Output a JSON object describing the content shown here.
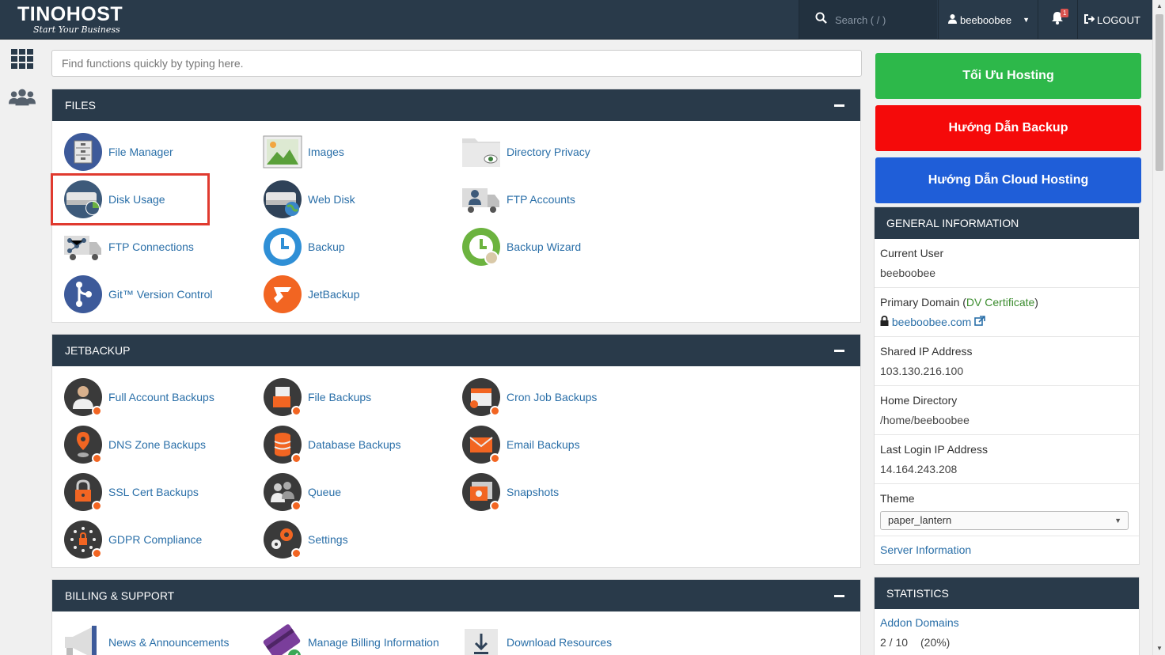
{
  "topbar": {
    "brand": "TINOHOST",
    "tagline": "Start Your Business",
    "search_placeholder": "Search ( / )",
    "user": "beeboobee",
    "notification_count": "1",
    "logout_label": "LOGOUT"
  },
  "quick_search": {
    "placeholder": "Find functions quickly by typing here."
  },
  "files": {
    "title": "FILES",
    "items": [
      {
        "label": "File Manager",
        "icon": "file-manager-icon"
      },
      {
        "label": "Images",
        "icon": "images-icon"
      },
      {
        "label": "Directory Privacy",
        "icon": "directory-privacy-icon"
      },
      {
        "label": "Disk Usage",
        "icon": "disk-usage-icon"
      },
      {
        "label": "Web Disk",
        "icon": "web-disk-icon"
      },
      {
        "label": "FTP Accounts",
        "icon": "ftp-accounts-icon"
      },
      {
        "label": "FTP Connections",
        "icon": "ftp-connections-icon"
      },
      {
        "label": "Backup",
        "icon": "backup-icon"
      },
      {
        "label": "Backup Wizard",
        "icon": "backup-wizard-icon"
      },
      {
        "label": "Git™ Version Control",
        "icon": "git-icon"
      },
      {
        "label": "JetBackup",
        "icon": "jetbackup-icon"
      }
    ]
  },
  "jetbackup": {
    "title": "JETBACKUP",
    "items": [
      {
        "label": "Full Account Backups"
      },
      {
        "label": "File Backups"
      },
      {
        "label": "Cron Job Backups"
      },
      {
        "label": "DNS Zone Backups"
      },
      {
        "label": "Database Backups"
      },
      {
        "label": "Email Backups"
      },
      {
        "label": "SSL Cert Backups"
      },
      {
        "label": "Queue"
      },
      {
        "label": "Snapshots"
      },
      {
        "label": "GDPR Compliance"
      },
      {
        "label": "Settings"
      }
    ]
  },
  "billing": {
    "title": "BILLING & SUPPORT",
    "items": [
      {
        "label": "News & Announcements"
      },
      {
        "label": "Manage Billing Information"
      },
      {
        "label": "Download Resources"
      }
    ]
  },
  "cta": {
    "optimize": "Tối Ưu Hosting",
    "backup_guide": "Hướng Dẫn Backup",
    "cloud_guide": "Hướng Dẫn Cloud Hosting",
    "colors": {
      "green": "#2db84a",
      "red": "#f50a0a",
      "blue": "#1f5ed8"
    }
  },
  "general_info": {
    "title": "GENERAL INFORMATION",
    "current_user_label": "Current User",
    "current_user": "beeboobee",
    "primary_domain_label": "Primary Domain",
    "dv_certificate": "DV Certificate",
    "domain": "beeboobee.com",
    "shared_ip_label": "Shared IP Address",
    "shared_ip": "103.130.216.100",
    "home_dir_label": "Home Directory",
    "home_dir": "/home/beeboobee",
    "last_login_label": "Last Login IP Address",
    "last_login_ip": "14.164.243.208",
    "theme_label": "Theme",
    "theme_value": "paper_lantern",
    "server_info": "Server Information"
  },
  "statistics": {
    "title": "STATISTICS",
    "addon_domains_label": "Addon Domains",
    "addon_domains_value": "2 / 10",
    "addon_domains_percent": "(20%)"
  }
}
